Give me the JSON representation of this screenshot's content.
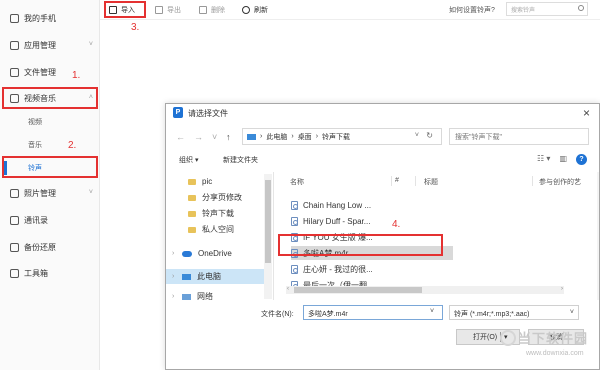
{
  "sidebar": {
    "items": [
      {
        "label": "我的手机",
        "icon": "phone-icon"
      },
      {
        "label": "应用管理",
        "icon": "apps-icon"
      },
      {
        "label": "文件管理",
        "icon": "folder-icon"
      },
      {
        "label": "视频音乐",
        "icon": "media-icon"
      },
      {
        "label": "照片管理",
        "icon": "photo-icon"
      },
      {
        "label": "通讯录",
        "icon": "contacts-icon"
      },
      {
        "label": "备份还原",
        "icon": "backup-icon"
      },
      {
        "label": "工具箱",
        "icon": "toolbox-icon"
      }
    ],
    "sub_items": [
      "视频",
      "音乐",
      "铃声"
    ]
  },
  "annotations": {
    "n1": "1.",
    "n2": "2.",
    "n3": "3.",
    "n4": "4."
  },
  "toolbar": {
    "import": "导入",
    "export": "导出",
    "delete": "删除",
    "refresh": "刷新",
    "help_link": "如何设置铃声?",
    "search_placeholder": "搜索铃声"
  },
  "dialog": {
    "title": "请选择文件",
    "breadcrumb": [
      "此电脑",
      "桌面",
      "铃声下载"
    ],
    "search_placeholder": "搜索\"铃声下载\"",
    "organize": "组织 ▾",
    "new_folder": "新建文件夹",
    "tree": [
      {
        "label": "pic",
        "type": "folder"
      },
      {
        "label": "分享页修改",
        "type": "folder"
      },
      {
        "label": "铃声下载",
        "type": "folder"
      },
      {
        "label": "私人空间",
        "type": "folder"
      },
      {
        "label": "OneDrive",
        "type": "cloud"
      },
      {
        "label": "此电脑",
        "type": "pc"
      },
      {
        "label": "网络",
        "type": "pc"
      }
    ],
    "columns": [
      "名称",
      "#",
      "标题",
      "参与创作的艺"
    ],
    "files": [
      "Chain Hang Low ...",
      "Hilary Duff - Spar...",
      "IF YOU 女生版 爆...",
      "多啦A梦.m4r",
      "庄心妍 - 我过的很...",
      "最后一次（伊一翻..."
    ],
    "selected_file_index": 3,
    "filename_label": "文件名(N):",
    "filename_value": "多啦A梦.m4r",
    "file_type": "铃声 (*.m4r;*.mp3;*.aac)",
    "open_label": "打开(O)",
    "cancel_label": "取消"
  },
  "watermark": {
    "big": "当下软件园",
    "small": "www.downxia.com"
  },
  "colors": {
    "accent": "#1e72d4",
    "annotation": "#e43131"
  }
}
